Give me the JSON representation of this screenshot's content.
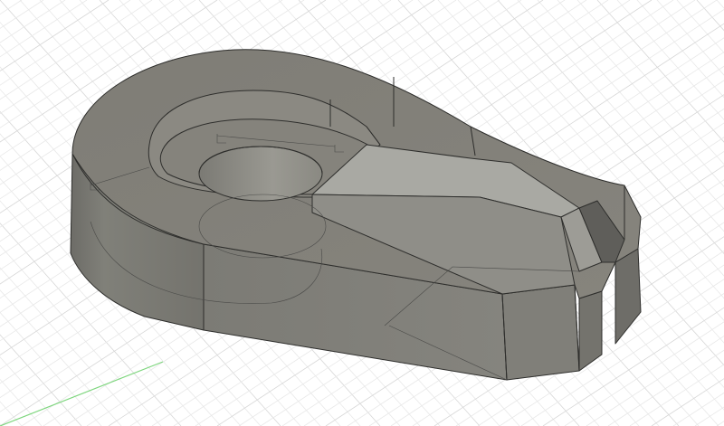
{
  "viewport": {
    "background": "#ffffff",
    "grid_minor_color": "#e8e8e8",
    "grid_major_color": "#d7d7d7",
    "axis_color": "#7ed67e"
  },
  "model": {
    "part_icon": "cad-part-3d-icon",
    "colors": {
      "top_face": "#817f78",
      "side_face_light": "#7a7973",
      "side_face_dark": "#6a6964",
      "inner_wall": "#8a8881",
      "hole_inner": "#96948d",
      "ramp_light": "#a8a8a2",
      "ramp_mid": "#8f8e88",
      "edge_line": "#2e2e2c",
      "hidden_line": "#4a4a48"
    }
  }
}
